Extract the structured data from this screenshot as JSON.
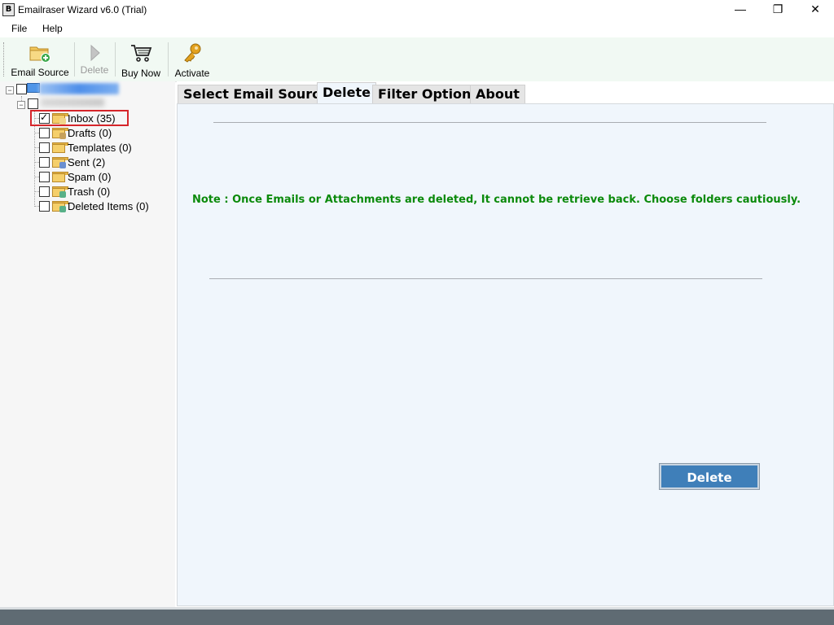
{
  "window": {
    "title": "Emailraser Wizard v6.0 (Trial)",
    "app_icon_letter": "B",
    "controls": {
      "minimize": "—",
      "maximize": "❐",
      "close": "✕"
    }
  },
  "menu": {
    "file": "File",
    "help": "Help"
  },
  "toolbar": {
    "email_source": "Email Source",
    "delete": "Delete",
    "buy_now": "Buy Now",
    "activate": "Activate"
  },
  "tree": {
    "folders": [
      {
        "label": "Inbox (35)",
        "checked": true
      },
      {
        "label": "Drafts (0)",
        "checked": false
      },
      {
        "label": "Templates (0)",
        "checked": false
      },
      {
        "label": "Sent (2)",
        "checked": false
      },
      {
        "label": "Spam (0)",
        "checked": false
      },
      {
        "label": "Trash (0)",
        "checked": false
      },
      {
        "label": "Deleted Items (0)",
        "checked": false
      }
    ]
  },
  "tabs": {
    "select_email_source": "Select Email Source",
    "delete": "Delete",
    "filter_options": "Filter Options",
    "about": "About",
    "active": "Delete"
  },
  "content": {
    "note": "Note : Once Emails or Attachments are deleted, It cannot be retrieve back. Choose folders cautiously.",
    "delete_button": "Delete"
  },
  "colors": {
    "note_green": "#0b8a0b",
    "button_blue": "#3f7fb9",
    "highlight_red": "#d6252a",
    "toolbar_bg": "#f1f9f3",
    "content_bg": "#f0f6fc"
  }
}
